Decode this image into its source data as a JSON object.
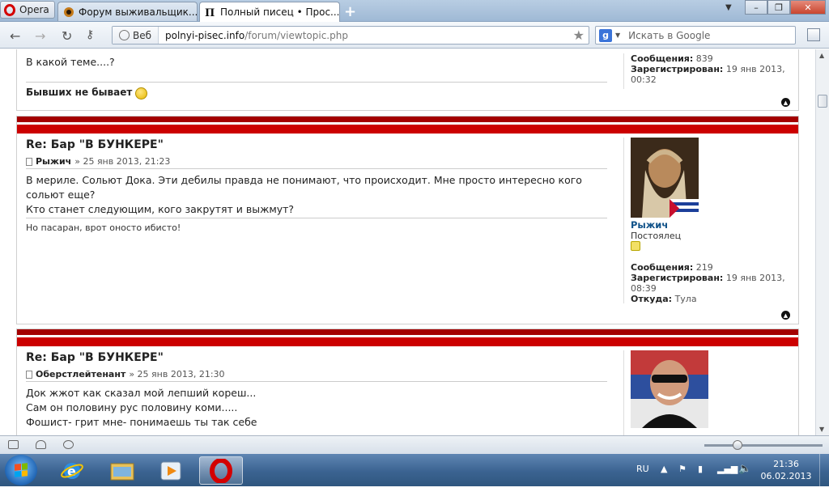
{
  "browser": {
    "opera_label": "Opera",
    "tabs": [
      {
        "label": "Форум выживальщик...",
        "close": "✕"
      },
      {
        "label": "Полный писец • Прос...",
        "close": "✕"
      }
    ],
    "new_tab": "+",
    "address": {
      "search_engine": "Веб",
      "host": "polnyi-pisec.info",
      "path": "/forum/viewtopic.php"
    },
    "search": {
      "placeholder": "Искать в Google",
      "engine_letter": "g"
    }
  },
  "posts": [
    {
      "body_lines": [
        "В какой теме....?"
      ],
      "signature": "Бывших не бывает",
      "profile": {
        "messages_label": "Сообщения:",
        "messages": "839",
        "registered_label": "Зарегистрирован:",
        "registered": "19 янв 2013, 00:32"
      }
    },
    {
      "title": "Re: Бар \"В БУНКЕРЕ\"",
      "author": "Рыжич",
      "date": "» 25 янв 2013, 21:23",
      "body_lines": [
        "В мериле. Сольют Дока. Эти дебилы правда не понимают, что происходит. Мне просто интересно кого сольют еще?",
        "Кто станет следующим, кого закрутят и выжмут?"
      ],
      "signature": "Но пасаран, врот оносто ибисто!",
      "profile": {
        "username": "Рыжич",
        "rank": "Постоялец",
        "messages_label": "Сообщения:",
        "messages": "219",
        "registered_label": "Зарегистрирован:",
        "registered": "19 янв 2013, 08:39",
        "location_label": "Откуда:",
        "location": "Тула"
      }
    },
    {
      "title": "Re: Бар \"В БУНКЕРЕ\"",
      "author": "Оберстлейтенант",
      "date": "» 25 янв 2013, 21:30",
      "body_lines": [
        "Док жжот как сказал мой лепший кореш...",
        "Сам он половину рус половину коми.....",
        "Фошист- грит мне- понимаешь ты так себе"
      ]
    }
  ],
  "taskbar": {
    "language": "RU",
    "time": "21:36",
    "date": "06.02.2013"
  },
  "colors": {
    "post_header": "#c00000",
    "username": "#105289"
  }
}
